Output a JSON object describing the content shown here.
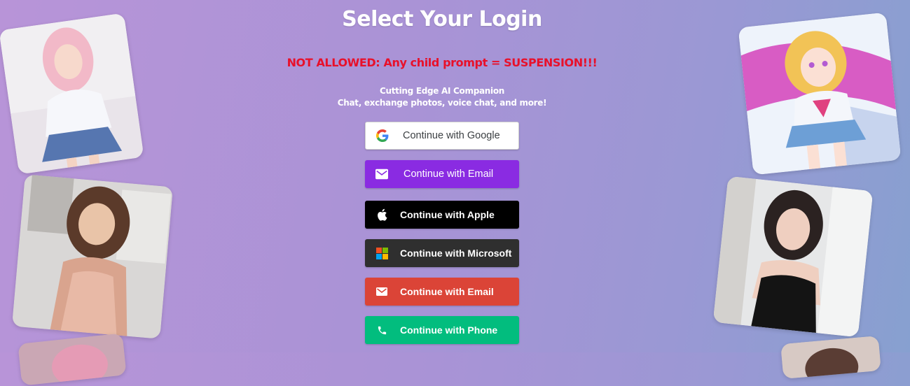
{
  "header": {
    "title": "Select Your Login",
    "warning": "NOT ALLOWED: Any child prompt = SUSPENSION!!!",
    "tagline_line1": "Cutting Edge AI Companion",
    "tagline_line2": "Chat, exchange photos, voice chat, and more!"
  },
  "login_buttons": {
    "google": "Continue with Google",
    "email_primary": "Continue with Email",
    "apple": "Continue with Apple",
    "microsoft": "Continue with Microsoft",
    "email_secondary": "Continue with Email",
    "phone": "Continue with Phone"
  },
  "icons": {
    "google": "google-icon",
    "email": "envelope-icon",
    "apple": "apple-icon",
    "microsoft": "microsoft-icon",
    "phone": "phone-icon"
  },
  "colors": {
    "google_bg": "#ffffff",
    "email_primary_bg": "#8a2be2",
    "apple_bg": "#000000",
    "microsoft_bg": "#2f2f2f",
    "email_secondary_bg": "#db4437",
    "phone_bg": "#02bd7e",
    "warning_text": "#e8102a"
  }
}
